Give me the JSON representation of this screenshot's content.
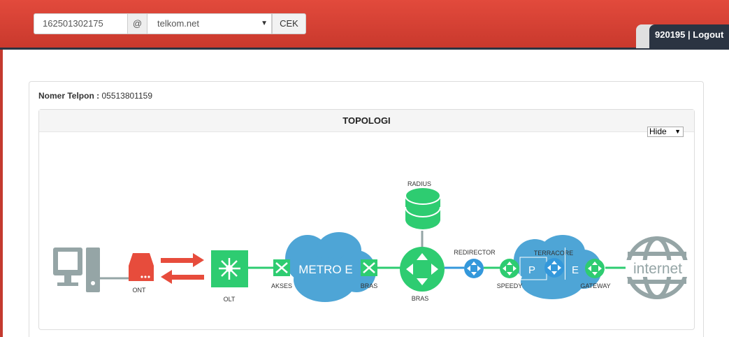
{
  "header": {
    "number_value": "162501302175",
    "at_symbol": "@",
    "domain_value": "telkom.net",
    "cek_label": "CEK",
    "user_id": "920195",
    "separator": " | ",
    "logout_label": "Logout"
  },
  "info": {
    "phone_label": "Nomer Telpon :",
    "phone_value": "05513801159"
  },
  "topology": {
    "title": "TOPOLOGI",
    "hide_option": "Hide",
    "labels": {
      "ont": "ONT",
      "olt": "OLT",
      "akses": "AKSES",
      "metro": "METRO E",
      "bras_switch": "BRAS",
      "radius": "RADIUS",
      "bras": "BRAS",
      "redirector": "REDIRECTOR",
      "terracore": "TERRACORE",
      "speedy": "SPEEDY",
      "p": "P",
      "e": "E",
      "gateway": "GATEWAY",
      "internet": "internet"
    }
  },
  "colors": {
    "header_red": "#d9412f",
    "dark_navy": "#2b3442",
    "node_green": "#2ecc71",
    "link_green": "#2ecc71",
    "cloud_blue": "#4ea5d6",
    "router_blue": "#3498db",
    "ont_red": "#e74c3c",
    "gray": "#95a5a6"
  }
}
